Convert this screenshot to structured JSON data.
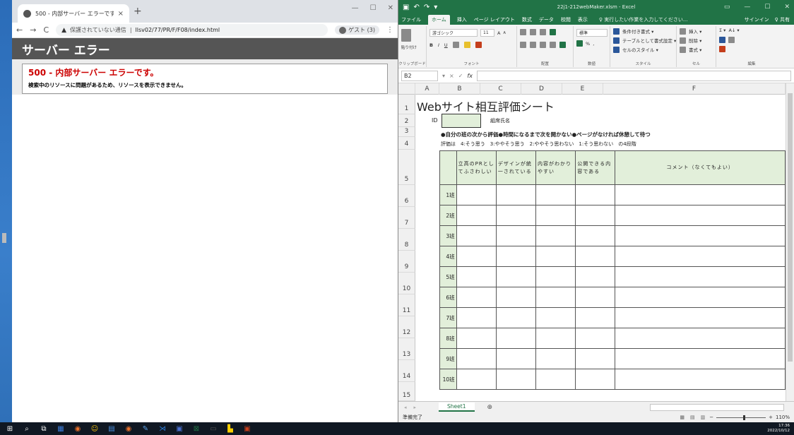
{
  "browser": {
    "tab_title": "500 - 内部サーバー エラーです。",
    "tab_close": "×",
    "new_tab": "+",
    "window_controls": [
      "—",
      "☐",
      "✕"
    ],
    "nav": [
      "←",
      "→",
      "C"
    ],
    "security_icon": "▲",
    "security_text": "保護されていない通信",
    "url": "llsv02/77/PR/F/F08/index.html",
    "profile_label": "ゲスト (3)",
    "menu_icon": "⋮"
  },
  "error_page": {
    "header": "サーバー エラー",
    "title": "500 - 内部サーバー エラーです。",
    "message": "検索中のリソースに問題があるため、リソースを表示できません。"
  },
  "excel": {
    "qat": [
      "▣",
      "↶",
      "↷",
      "▾"
    ],
    "file_title": "22j1-212webMaker.xlsm - Excel",
    "window_controls": [
      "▭",
      "—",
      "☐",
      "✕"
    ],
    "menu_tabs": [
      "ファイル",
      "ホーム",
      "挿入",
      "ページ レイアウト",
      "数式",
      "データ",
      "校閲",
      "表示"
    ],
    "tell_me": "♀ 実行したい作業を入力してください...",
    "signin": "サインイン",
    "share": "♀ 共有",
    "ribbon": {
      "clipboard": {
        "paste": "貼り付け",
        "label": "クリップボード"
      },
      "font": {
        "name": "游ゴシック",
        "size": "11",
        "grow": "A",
        "shrink": "A",
        "bold": "B",
        "italic": "I",
        "underline": "U",
        "label": "フォント"
      },
      "alignment": {
        "label": "配置"
      },
      "number": {
        "format": "標準",
        "percent": "%",
        "comma": ",",
        "label": "数値"
      },
      "styles": {
        "cond": "条件付き書式 ▾",
        "table": "テーブルとして書式設定 ▾",
        "cell": "セルのスタイル ▾",
        "label": "スタイル"
      },
      "cells": {
        "insert": "挿入 ▾",
        "delete": "削除 ▾",
        "format": "書式 ▾",
        "label": "セル"
      },
      "editing": {
        "sum": "Σ ▾",
        "sort": "A↓ ▾",
        "label": "編集"
      }
    },
    "name_box": "B2",
    "formula_buttons": [
      "▾",
      "×",
      "✓",
      "fx"
    ],
    "columns": [
      "A",
      "B",
      "C",
      "D",
      "E",
      "F"
    ],
    "rows": [
      "1",
      "2",
      "3",
      "4",
      "5",
      "6",
      "7",
      "8",
      "9",
      "10",
      "11",
      "12",
      "13",
      "14",
      "15"
    ],
    "sheet": {
      "title": "Webサイト相互評価シート",
      "id_label": "ID",
      "name_label": "組席氏名",
      "rule1": "●自分の班の次から評価●時間になるまで次を開かない●ページがなければ休憩して待つ",
      "rule2": "評価は　4:そう思う　3:ややそう思う　2:ややそう思わない　1:そう思わない　の4段階",
      "headers": [
        "立高のPRとしてふさわしい",
        "デザインが統一されている",
        "内容がわかりやすい",
        "公開できる内容である",
        "コメント（なくてもよい）"
      ],
      "groups": [
        "1班",
        "2班",
        "3班",
        "4班",
        "5班",
        "6班",
        "7班",
        "8班",
        "9班",
        "10班"
      ]
    },
    "sheet_tab": "Sheet1",
    "add_sheet": "⊕",
    "status": "準備完了",
    "zoom": "110%"
  },
  "taskbar": {
    "icons": [
      "⊞",
      "⌕",
      "⧉",
      "▦",
      "◉",
      "☺",
      "▤",
      "◉",
      "✎",
      "⋊",
      "▣",
      "⊠",
      "▭",
      "▙",
      "▣"
    ],
    "time": "17:36",
    "date": "2022/10/12"
  },
  "colors": {
    "excel_green": "#217346",
    "cell_fill": "#e2efda",
    "error_red": "#cc0000",
    "error_header": "#555555"
  }
}
